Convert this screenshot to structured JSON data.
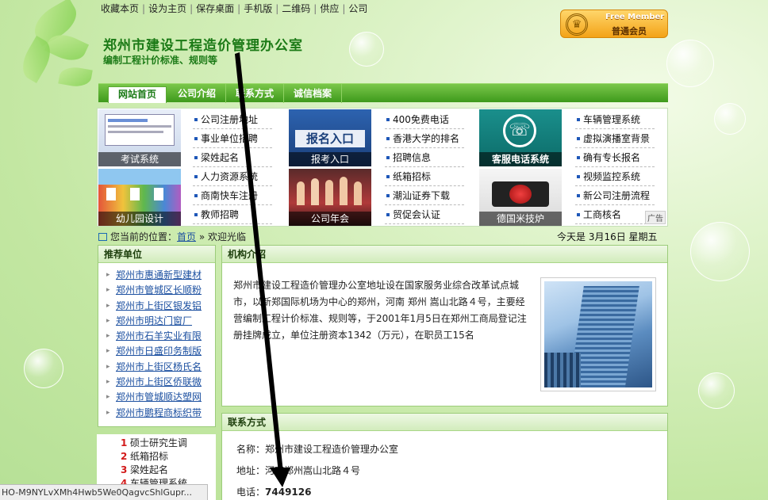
{
  "top_links": [
    "收藏本页",
    "设为主页",
    "保存桌面",
    "手机版",
    "二维码",
    "供应",
    "公司"
  ],
  "header": {
    "title": "郑州市建设工程造价管理办公室",
    "subtitle": "编制工程计价标准、规则等"
  },
  "member_badge": {
    "line1": "Free Member",
    "line2": "普通会员"
  },
  "nav": [
    "网站首页",
    "公司介绍",
    "联系方式",
    "诚信档案"
  ],
  "ads": {
    "thumbs": [
      "考试系统",
      "报考入口",
      "客服电话系统",
      "幼儿园设计",
      "公司年会",
      "德国米技炉"
    ],
    "col1": [
      "公司注册地址",
      "事业单位招聘",
      "梁姓起名",
      "人力资源系统",
      "商南快车注册",
      "教师招聘"
    ],
    "col2": [
      "400免费电话",
      "香港大学的排名",
      "招聘信息",
      "纸箱招标",
      "潮汕证券下载",
      "贸促会认证"
    ],
    "col3": [
      "车辆管理系统",
      "虚拟演播室背景",
      "确有专长报名",
      "视频监控系统",
      "新公司注册流程",
      "工商核名"
    ],
    "banner_text": "报名入口",
    "ad_tag": "广告"
  },
  "breadcrumb": {
    "prefix": "您当前的位置：",
    "home": "首页",
    "sep": "»",
    "current": "欢迎光临"
  },
  "today": "今天是 3月16日 星期五",
  "recommend": {
    "title": "推荐单位",
    "items": [
      "郑州市惠通新型建材",
      "郑州市管城区长顺粉",
      "郑州市上街区银发铝",
      "郑州市明达门窗厂",
      "郑州市石羊实业有限",
      "郑州市日盛印务制版",
      "郑州市上街区杨氏名",
      "郑州市上街区侨联微",
      "郑州市管城顺达塑网",
      "郑州市鹏程商标织带"
    ]
  },
  "intro": {
    "title": "机构介绍",
    "text": "郑州市建设工程造价管理办公室地址设在国家服务业综合改革试点城市，以新郑国际机场为中心的郑州，河南 郑州 嵩山北路４号，主要经营编制工程计价标准、规则等，于2001年1月5日在郑州工商局登记注册挂牌成立，单位注册资本1342（万元），在职员工15名"
  },
  "contact": {
    "title": "联系方式",
    "name_label": "名称：",
    "name": "郑州市建设工程造价管理办公室",
    "addr_label": "地址：",
    "addr": "河南郑州嵩山北路４号",
    "tel_label": "电话：",
    "tel": "7449126"
  },
  "hot": [
    {
      "n": "1",
      "t": "硕士研究生调"
    },
    {
      "n": "2",
      "t": "纸箱招标"
    },
    {
      "n": "3",
      "t": "梁姓起名"
    },
    {
      "n": "4",
      "t": "车辆管理系统"
    }
  ],
  "status_url": "HO-M9NYLvXMh4Hwb5We0QagvcShlGupr..."
}
